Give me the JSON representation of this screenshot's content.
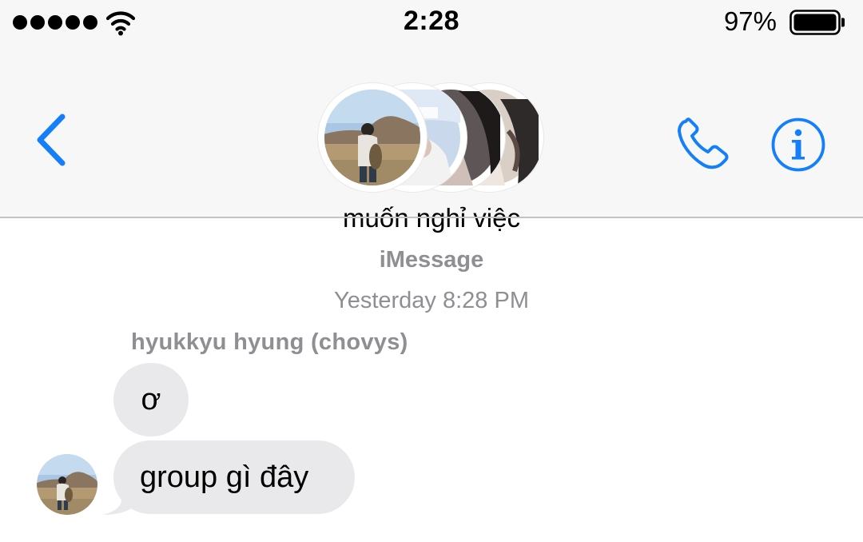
{
  "status_bar": {
    "time": "2:28",
    "battery_percent": "97%",
    "signal_bars": 5,
    "icons": [
      "signal-dots-icon",
      "wifi-icon",
      "battery-icon"
    ]
  },
  "header": {
    "group_name": "muốn nghỉ việc",
    "participant_avatar_count": 4,
    "icons": [
      "back-chevron-icon",
      "phone-icon",
      "info-icon"
    ]
  },
  "conversation": {
    "service_label": "iMessage",
    "timestamp": "Yesterday 8:28 PM",
    "sender_name": "hyukkyu hyung (chovys)",
    "messages": [
      {
        "text": "ơ"
      },
      {
        "text": "group gì đây"
      }
    ]
  },
  "colors": {
    "accent": "#147efb",
    "bar_background": "#f7f7f7",
    "bubble_incoming": "#e9e9eb",
    "secondary_text": "#8e8e93"
  }
}
